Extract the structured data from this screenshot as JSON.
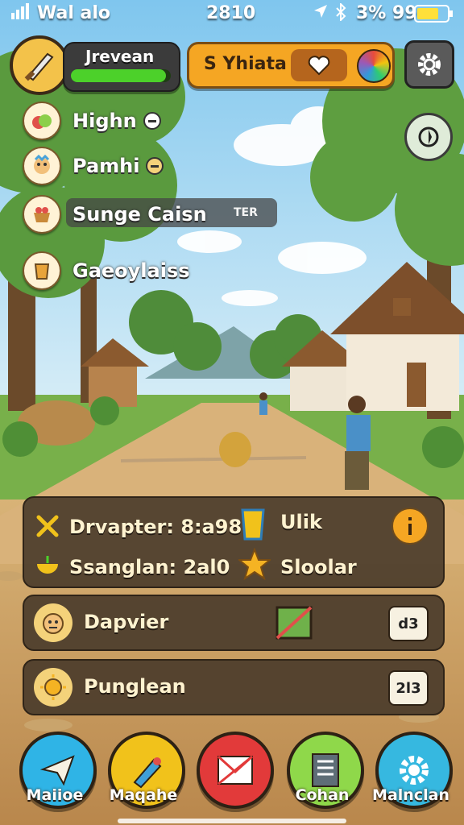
{
  "status_bar": {
    "carrier": "Wal alo",
    "time": "2810",
    "battery_text": "3% 99"
  },
  "profile": {
    "name": "Jrevean",
    "xp_progress": 0.95
  },
  "currency_bar": {
    "label": "S Yhiata"
  },
  "side_menu": [
    {
      "label": "Highn",
      "icon": "fruit-icon"
    },
    {
      "label": "Pamhi",
      "icon": "character-icon"
    },
    {
      "label": "Sunge Caisn",
      "icon": "basket-icon",
      "tag": "TER"
    },
    {
      "label": "Gaeoylaiss",
      "icon": "cup-icon"
    }
  ],
  "stats_panel": {
    "row1_left": "Drvapter: 8:a98",
    "row1_right": "Ulik",
    "row2_left": "Ssanglan: 2al0",
    "row2_right": "Sloolar"
  },
  "quest_rows": [
    {
      "label": "Dapvier",
      "badge": "d3"
    },
    {
      "label": "Punglean",
      "badge": "2l3"
    }
  ],
  "bottom_nav": [
    {
      "label": "Maiioe",
      "color": "#2fb4e6"
    },
    {
      "label": "Maqahe",
      "color": "#f1c21b"
    },
    {
      "label": "",
      "color": "#e23a3a"
    },
    {
      "label": "Cohan",
      "color": "#8fd84a"
    },
    {
      "label": "Malnclan",
      "color": "#36b8e0"
    }
  ]
}
